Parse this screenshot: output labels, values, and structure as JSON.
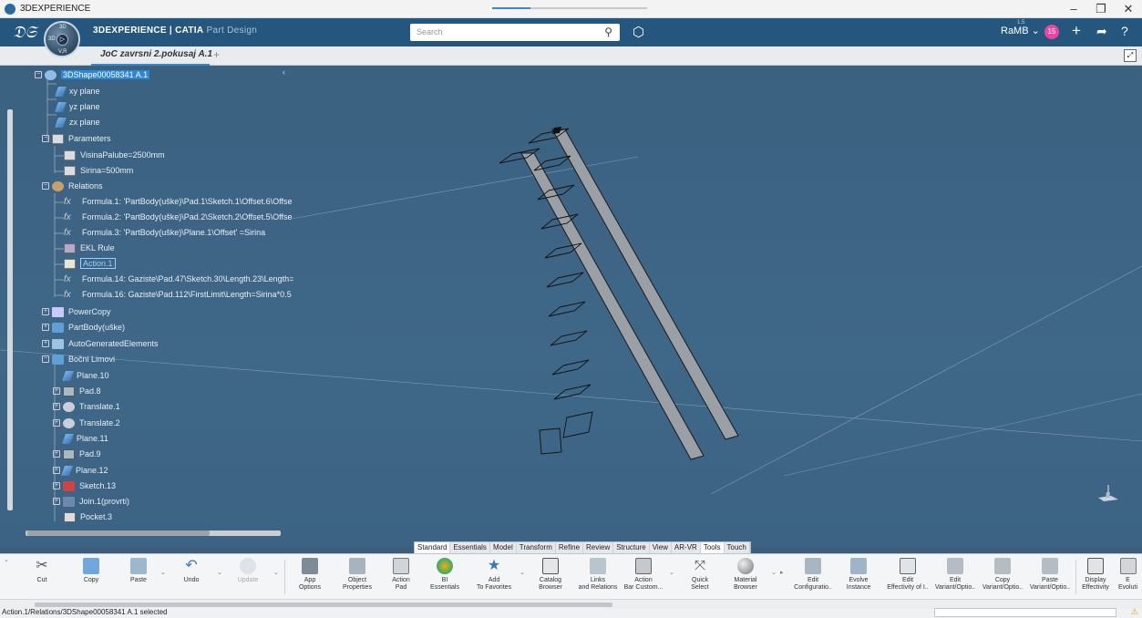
{
  "window": {
    "title": "3DEXPERIENCE"
  },
  "window_controls": {
    "minimize": "–",
    "restore": "❐",
    "close": "✕"
  },
  "topbar": {
    "logo": "3DS",
    "compass_labels": {
      "top": "3D",
      "left": "3D",
      "bottom": "V,R"
    },
    "brand_bold": "3DEXPERIENCE | CATIA",
    "brand_app": "Part Design",
    "search_placeholder": "Search",
    "user": "RaMB",
    "user_sup": "1.5",
    "notifications": "15"
  },
  "tabs": {
    "active": "JoC zavrsni 2.pokusaj A.1",
    "add": "+"
  },
  "tree": {
    "root": "3DShape00058341 A.1",
    "items": [
      {
        "label": "xy plane"
      },
      {
        "label": "yz plane"
      },
      {
        "label": "zx plane"
      },
      {
        "label": "Parameters"
      },
      {
        "label": "VisinaPalube=2500mm"
      },
      {
        "label": "Sirina=500mm"
      },
      {
        "label": "Relations"
      },
      {
        "label": "Formula.1: 'PartBody(uške)\\Pad.1\\Sketch.1\\Offset.6\\Offse"
      },
      {
        "label": "Formula.2: 'PartBody(uške)\\Pad.2\\Sketch.2\\Offset.5\\Offse"
      },
      {
        "label": "Formula.3: 'PartBody(uške)\\Plane.1\\Offset' =Sirina"
      },
      {
        "label": "EKL Rule"
      },
      {
        "label": "Action.1"
      },
      {
        "label": "Formula.14: Gaziste\\Pad.47\\Sketch.30\\Length.23\\Length="
      },
      {
        "label": "Formula.16: Gaziste\\Pad.112\\FirstLimit\\Length=Sirina*0.5"
      },
      {
        "label": "PowerCopy"
      },
      {
        "label": "PartBody(uške)"
      },
      {
        "label": "AutoGeneratedElements"
      },
      {
        "label": "Bočni Limovi"
      },
      {
        "label": "Plane.10"
      },
      {
        "label": "Pad.8"
      },
      {
        "label": "Translate.1"
      },
      {
        "label": "Translate.2"
      },
      {
        "label": "Plane.11"
      },
      {
        "label": "Pad.9"
      },
      {
        "label": "Plane.12"
      },
      {
        "label": "Sketch.13"
      },
      {
        "label": "Join.1(provrti)"
      },
      {
        "label": "Pocket.3"
      }
    ]
  },
  "ribbon_tabs": [
    "Standard",
    "Essentials",
    "Model",
    "Transform",
    "Refine",
    "Review",
    "Structure",
    "View",
    "AR-VR",
    "Tools",
    "Touch"
  ],
  "ribbon_active_tab": "Tools",
  "ribbon": [
    {
      "l1": "Cut",
      "l2": ""
    },
    {
      "l1": "Copy",
      "l2": ""
    },
    {
      "l1": "Paste",
      "l2": ""
    },
    {
      "l1": "Undo",
      "l2": ""
    },
    {
      "l1": "Update",
      "l2": ""
    },
    {
      "l1": "App",
      "l2": "Options"
    },
    {
      "l1": "Object",
      "l2": "Properties"
    },
    {
      "l1": "Action",
      "l2": "Pad"
    },
    {
      "l1": "BI",
      "l2": "Essentials"
    },
    {
      "l1": "Add",
      "l2": "To Favorites"
    },
    {
      "l1": "Catalog",
      "l2": "Browser"
    },
    {
      "l1": "Links",
      "l2": "and Relations"
    },
    {
      "l1": "Action",
      "l2": "Bar Custom..."
    },
    {
      "l1": "Quick",
      "l2": "Select"
    },
    {
      "l1": "Material",
      "l2": "Browser"
    },
    {
      "l1": "Edit",
      "l2": "Configuratio.."
    },
    {
      "l1": "Evolve",
      "l2": "Instance"
    },
    {
      "l1": "Edit",
      "l2": "Effectivity of I.."
    },
    {
      "l1": "Edit",
      "l2": "Variant/Optio.."
    },
    {
      "l1": "Copy",
      "l2": "Variant/Optio.."
    },
    {
      "l1": "Paste",
      "l2": "Variant/Optio.."
    },
    {
      "l1": "Display",
      "l2": "Effectivity"
    },
    {
      "l1": "E",
      "l2": "Evoluti"
    }
  ],
  "status": {
    "text": "Action.1/Relations/3DShape00058341 A.1 selected"
  },
  "colors": {
    "accent": "#25577e",
    "viewport": "#3f6787",
    "selection": "#2f86d8"
  }
}
